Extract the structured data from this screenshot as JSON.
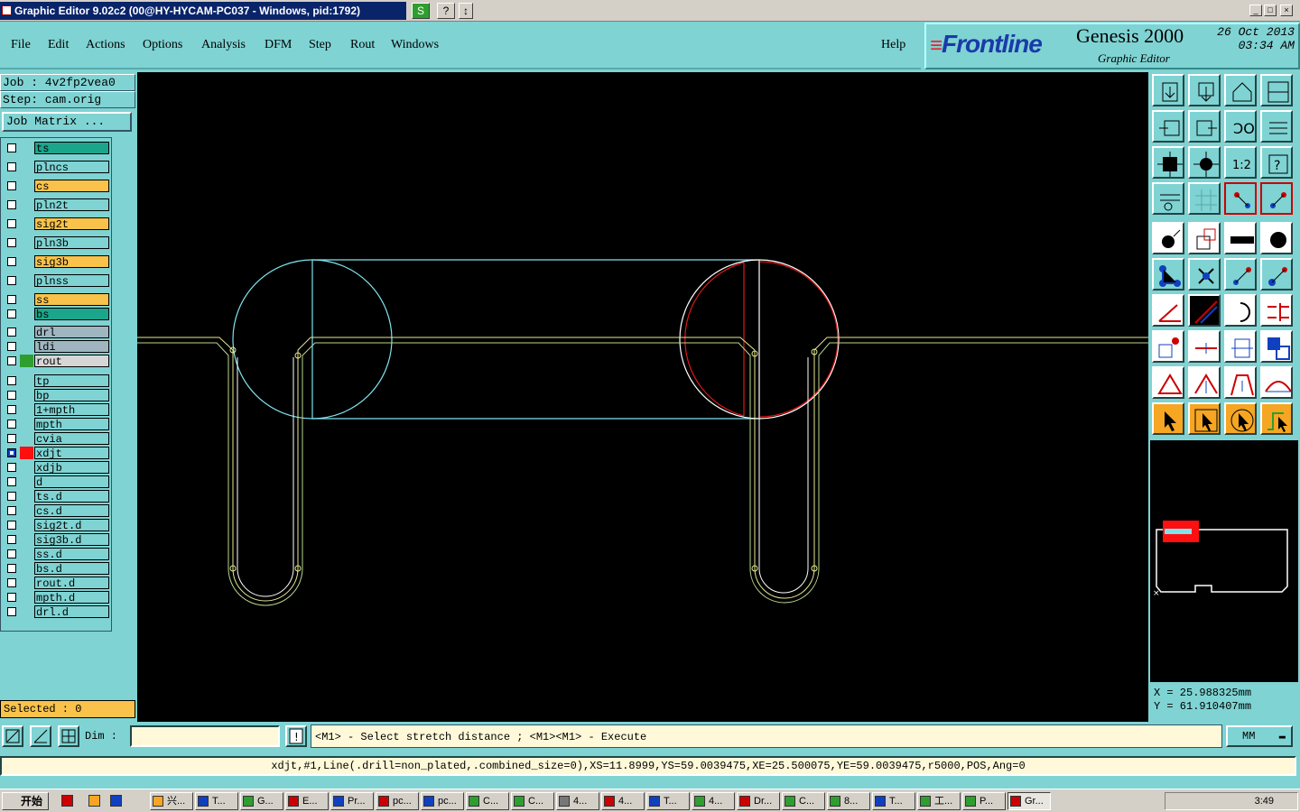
{
  "window": {
    "title": "Graphic Editor 9.02c2 (00@HY-HYCAM-PC037 - Windows, pid:1792)",
    "btn_s": "S",
    "btn_help": "?",
    "btn_arrow": "↕",
    "min": "_",
    "max": "□",
    "close": "×"
  },
  "menu": {
    "items": [
      "File",
      "Edit",
      "Actions",
      "Options",
      "Analysis",
      "DFM",
      "Step",
      "Rout",
      "Windows"
    ],
    "help": "Help"
  },
  "brand": {
    "logo": "Frontline",
    "product": "Genesis 2000",
    "subtitle": "Graphic Editor",
    "date": "26 Oct 2013",
    "time": "03:34 AM"
  },
  "job": {
    "job_label": "Job : 4v2fp2vea0",
    "step_label": "Step: cam.orig",
    "matrix_button": "Job Matrix ..."
  },
  "layers": [
    {
      "name": "ts",
      "color": "teal",
      "checked": false
    },
    {
      "name": "plncs",
      "color": "cyan",
      "checked": false
    },
    {
      "name": "cs",
      "color": "orange",
      "checked": false
    },
    {
      "name": "pln2t",
      "color": "cyan",
      "checked": false
    },
    {
      "name": "sig2t",
      "color": "orange",
      "checked": false
    },
    {
      "name": "pln3b",
      "color": "cyan",
      "checked": false
    },
    {
      "name": "sig3b",
      "color": "orange",
      "checked": false
    },
    {
      "name": "plnss",
      "color": "cyan",
      "checked": false
    },
    {
      "name": "ss",
      "color": "orange",
      "checked": false
    },
    {
      "name": "bs",
      "color": "teal",
      "checked": false
    },
    {
      "name": "drl",
      "color": "gray",
      "checked": false
    },
    {
      "name": "ldi",
      "color": "gray",
      "checked": false
    },
    {
      "name": "rout",
      "color": "lgray",
      "checked": false,
      "swatch": "#2e9e2e"
    },
    {
      "name": "tp",
      "color": "cyan",
      "checked": false
    },
    {
      "name": "bp",
      "color": "cyan",
      "checked": false
    },
    {
      "name": "1+mpth",
      "color": "cyan",
      "checked": false
    },
    {
      "name": "mpth",
      "color": "cyan",
      "checked": false
    },
    {
      "name": "cvia",
      "color": "cyan",
      "checked": false
    },
    {
      "name": "xdjt",
      "color": "cyan",
      "checked": true,
      "swatch": "#ff1010"
    },
    {
      "name": "xdjb",
      "color": "cyan",
      "checked": false
    },
    {
      "name": "d",
      "color": "cyan",
      "checked": false
    },
    {
      "name": "ts.d",
      "color": "cyan",
      "checked": false
    },
    {
      "name": "cs.d",
      "color": "cyan",
      "checked": false
    },
    {
      "name": "sig2t.d",
      "color": "cyan",
      "checked": false
    },
    {
      "name": "sig3b.d",
      "color": "cyan",
      "checked": false
    },
    {
      "name": "ss.d",
      "color": "cyan",
      "checked": false
    },
    {
      "name": "bs.d",
      "color": "cyan",
      "checked": false
    },
    {
      "name": "rout.d",
      "color": "cyan",
      "checked": false
    },
    {
      "name": "mpth.d",
      "color": "cyan",
      "checked": false
    },
    {
      "name": "drl.d",
      "color": "cyan",
      "checked": false
    }
  ],
  "selected": "Selected : 0",
  "coords": {
    "x": "X = 25.988325mm",
    "y": "Y = 61.910407mm"
  },
  "command": {
    "dim_label": "Dim :",
    "dim_value": "",
    "prompt": "<M1> - Select stretch distance ; <M1><M1> - Execute",
    "units": "MM"
  },
  "status": "xdjt,#1,Line(.drill=non_plated,.combined_size=0),XS=11.8999,YS=59.0039475,XE=25.500075,YE=59.0039475,r5000,POS,Ang=0",
  "taskbar": {
    "start": "开始",
    "tasks": [
      "兴...",
      "T...",
      "G...",
      "E...",
      "Pr...",
      "pc...",
      "pc...",
      "C...",
      "C...",
      "4...",
      "4...",
      "T...",
      "4...",
      "Dr...",
      "C...",
      "8...",
      "T...",
      "工...",
      "P...",
      "Gr..."
    ],
    "clock": "3:49"
  },
  "colors": {
    "panel": "#7fd3d3",
    "canvas": "#000000",
    "cyan_geom": "#7fe3ee",
    "yellow_geom": "#e8e890",
    "red_geom": "#e01818"
  }
}
